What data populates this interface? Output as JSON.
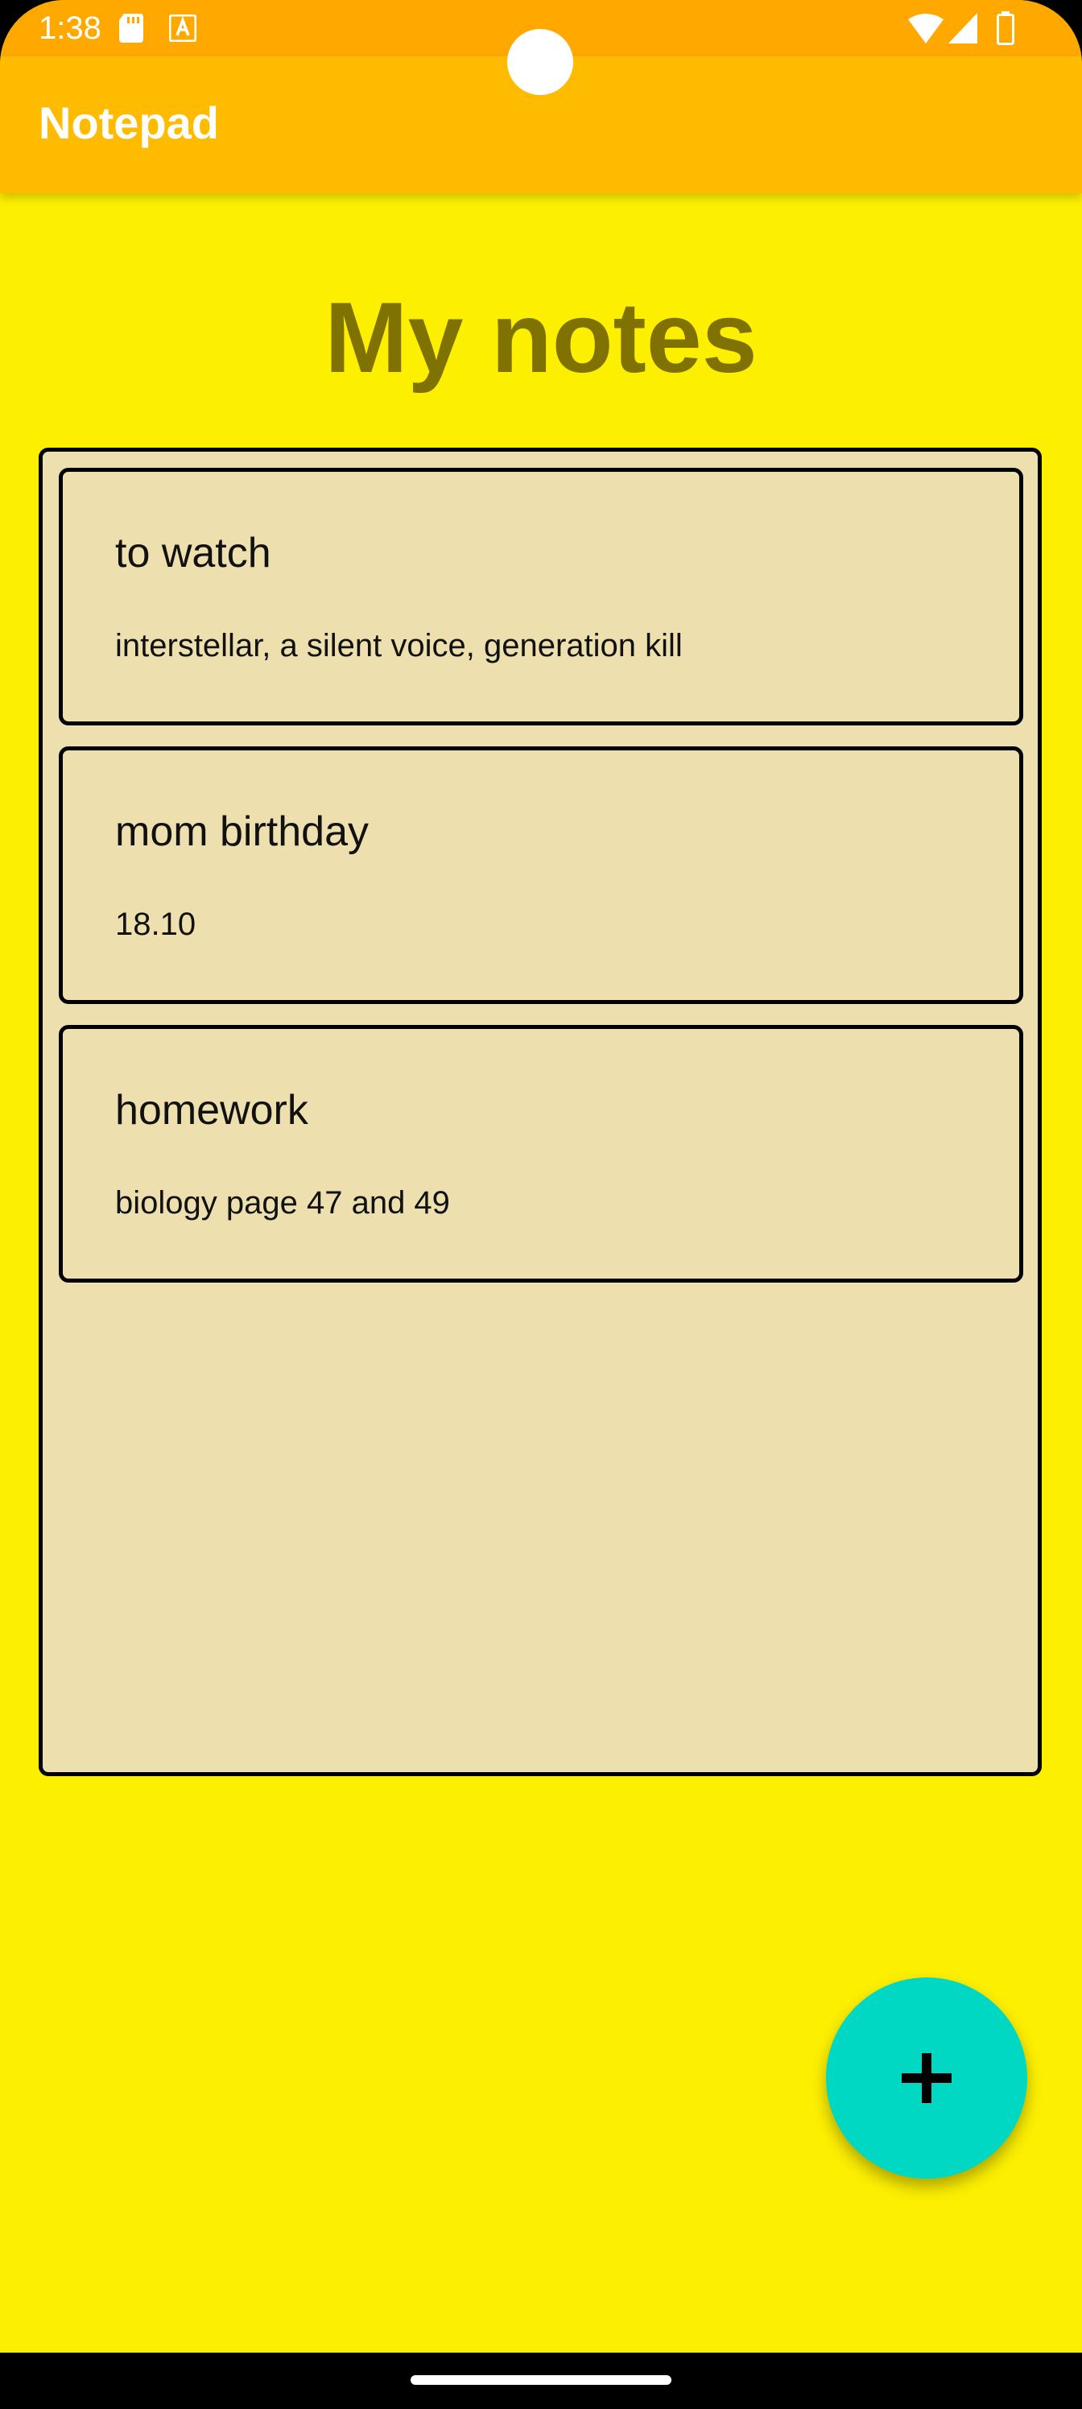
{
  "status_bar": {
    "time": "1:38",
    "icons": [
      "sd-card-icon",
      "a-notification-icon",
      "wifi-icon",
      "signal-icon",
      "battery-icon"
    ]
  },
  "app_bar": {
    "title": "Notepad"
  },
  "page": {
    "title": "My notes"
  },
  "notes": [
    {
      "title": "to watch",
      "body": "interstellar, a silent voice, generation kill"
    },
    {
      "title": "mom birthday",
      "body": "18.10"
    },
    {
      "title": "homework",
      "body": "biology page 47 and 49"
    }
  ],
  "fab": {
    "icon": "plus-icon"
  },
  "colors": {
    "background": "#FCEF00",
    "status_bar": "#FFA800",
    "app_bar": "#FFBB00",
    "title_text": "#7F7200",
    "note_card": "#EDE0AE",
    "fab": "#00D8C4"
  }
}
